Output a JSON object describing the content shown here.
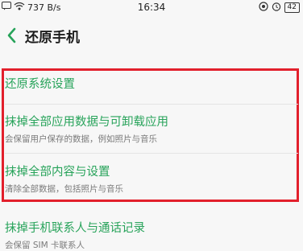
{
  "status_bar": {
    "network_speed": "737 B/s",
    "time": "16:34",
    "battery": "42"
  },
  "header": {
    "title": "还原手机"
  },
  "items": [
    {
      "title": "还原系统设置",
      "subtitle": ""
    },
    {
      "title": "抹掉全部应用数据与可卸载应用",
      "subtitle": "会保留用户保存的数据，例如照片与音乐"
    },
    {
      "title": "抹掉全部内容与设置",
      "subtitle": "清除全部数据，包括照片与音乐"
    },
    {
      "title": "抹掉手机联系人与通话记录",
      "subtitle": "会保留 SIM 卡联系人"
    }
  ],
  "colors": {
    "accent_green": "#27a35a",
    "highlight_red": "#e2202c"
  }
}
